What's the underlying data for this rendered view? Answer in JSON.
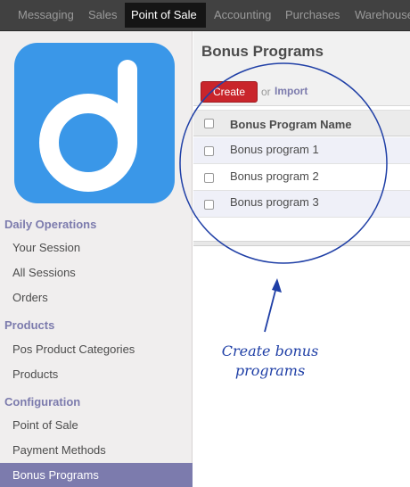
{
  "top_menu": {
    "items": [
      "Messaging",
      "Sales",
      "Point of Sale",
      "Accounting",
      "Purchases",
      "Warehouse"
    ],
    "active": "Point of Sale"
  },
  "sidebar": {
    "sections": [
      {
        "title": "Daily Operations",
        "items": [
          "Your Session",
          "All Sessions",
          "Orders"
        ]
      },
      {
        "title": "Products",
        "items": [
          "Pos Product Categories",
          "Products"
        ]
      },
      {
        "title": "Configuration",
        "items": [
          "Point of Sale",
          "Payment Methods",
          "Bonus Programs"
        ]
      }
    ],
    "active_item": "Bonus Programs",
    "logo_color": "#3a97e8"
  },
  "main": {
    "title": "Bonus Programs",
    "create_label": "Create",
    "or_text": "or",
    "import_label": "Import",
    "column_header": "Bonus Program Name",
    "rows": [
      "Bonus program 1",
      "Bonus program 2",
      "Bonus program 3"
    ]
  },
  "annotation": {
    "text_line1": "Create bonus",
    "text_line2": "programs",
    "color": "#1f3fa6"
  }
}
